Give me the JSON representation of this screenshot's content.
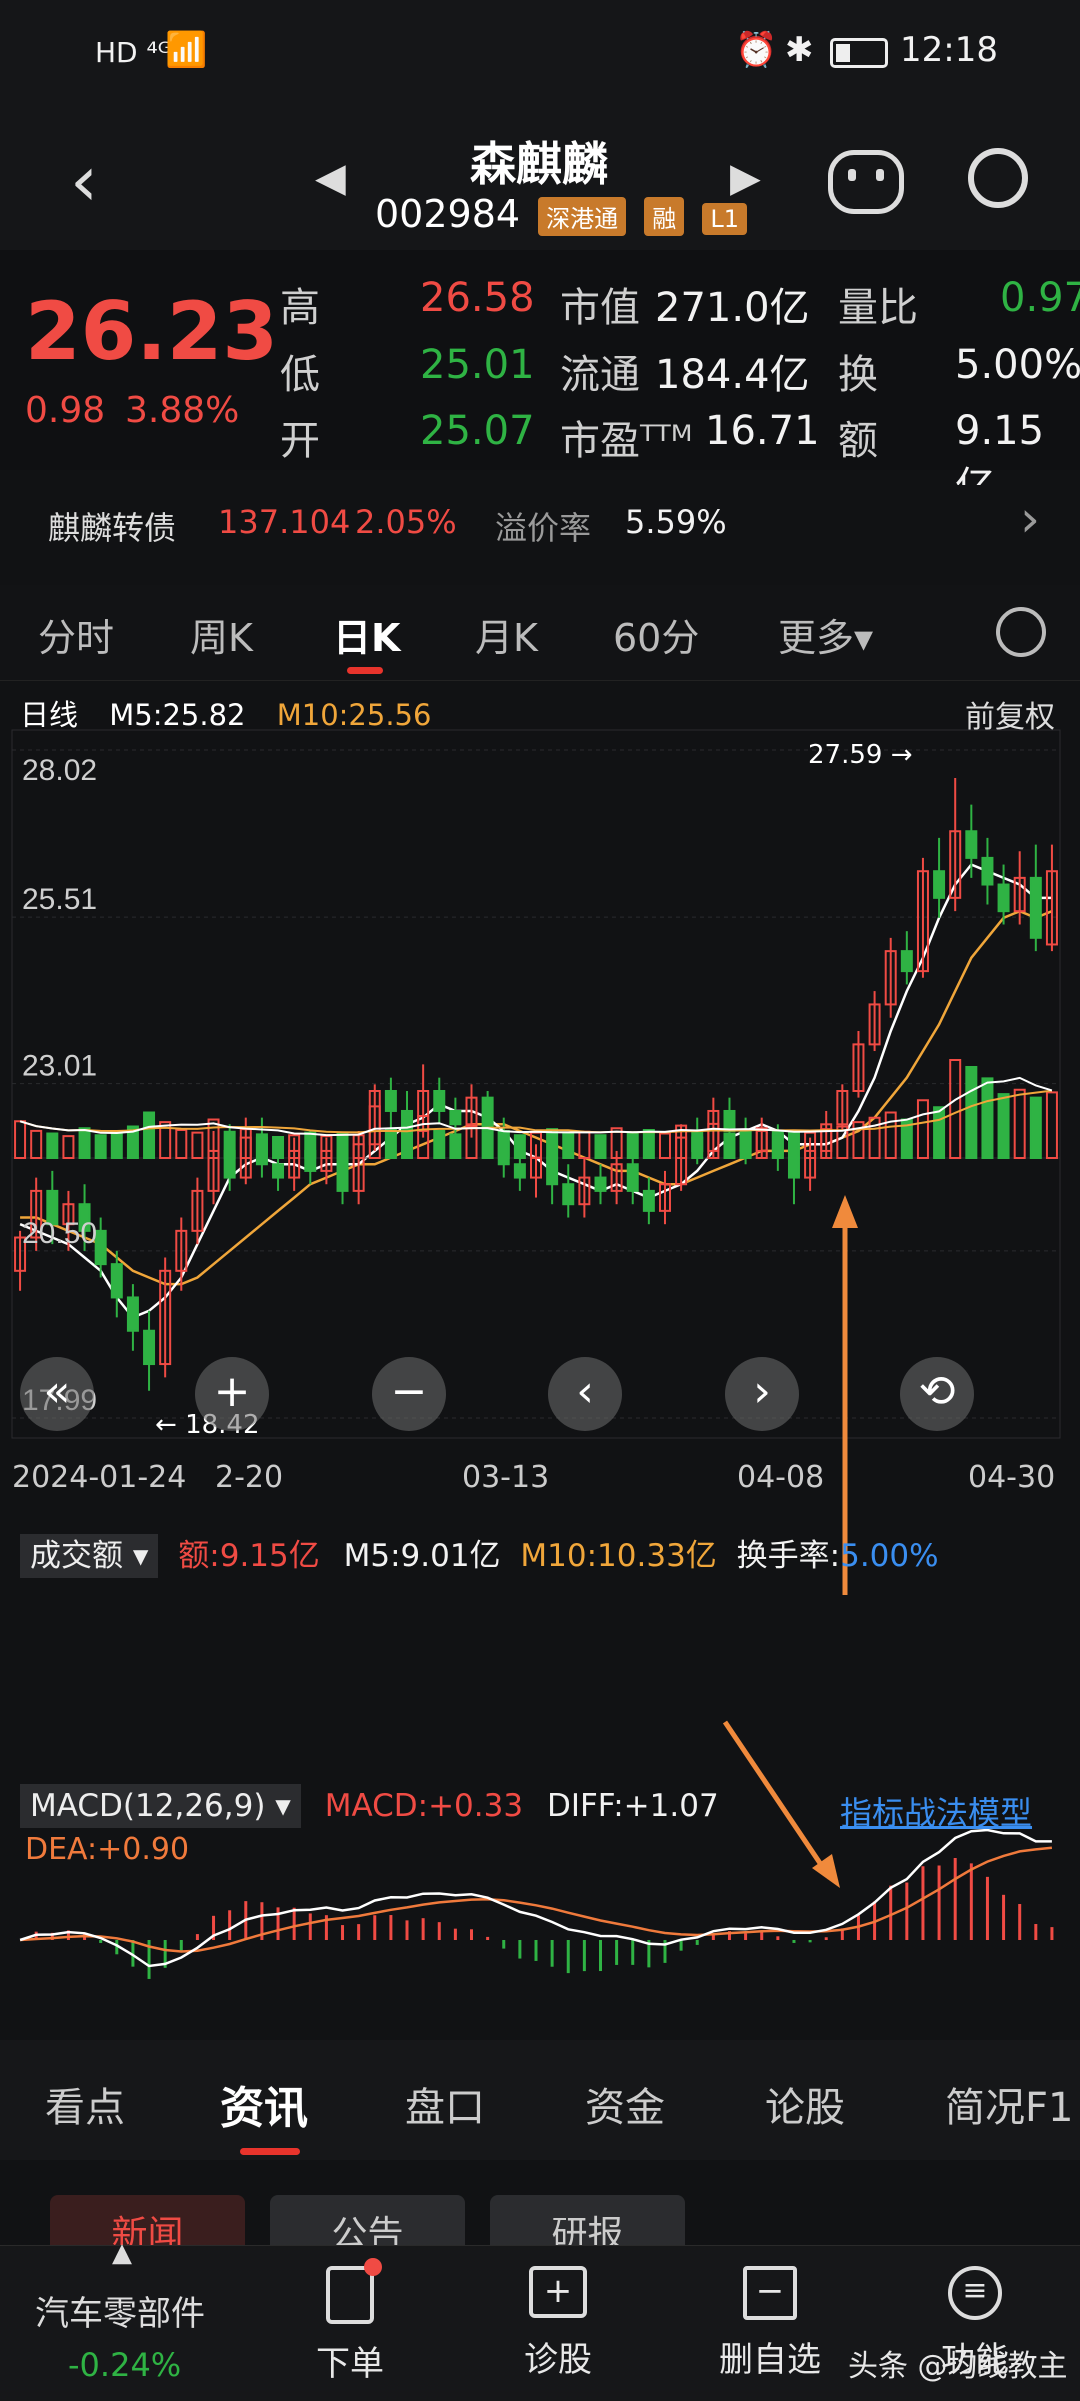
{
  "status_bar": {
    "network": "HD ⁴ᴳ",
    "time": "12:18"
  },
  "header": {
    "stock_name": "森麒麟",
    "stock_code": "002984",
    "badges": [
      "深港通",
      "融",
      "L1"
    ]
  },
  "quote": {
    "price": "26.23",
    "change": "0.98",
    "change_pct": "3.88%",
    "rows": [
      {
        "l1": "高",
        "v1": "26.58",
        "l2": "市值",
        "v2": "271.0亿",
        "l3": "量比",
        "v3": "0.97"
      },
      {
        "l1": "低",
        "v1": "25.01",
        "l2": "流通",
        "v2": "184.4亿",
        "l3": "换",
        "v3": "5.00%"
      },
      {
        "l1": "开",
        "v1": "25.07",
        "l2": "市盈ᵀᵀᴹ",
        "v2": "16.71",
        "l3": "额",
        "v3": "9.15亿"
      }
    ]
  },
  "bond": {
    "name": "麒麟转债",
    "price": "137.104",
    "pct": "2.05%",
    "premium_label": "溢价率",
    "premium": "5.59%"
  },
  "tabs": [
    "分时",
    "周K",
    "日K",
    "月K",
    "60分",
    "更多▾"
  ],
  "active_tab": "日K",
  "kline": {
    "label": "日线",
    "m5": "M5:25.82",
    "m10": "M10:25.56",
    "adjust": "前复权",
    "high_marker": "27.59",
    "low_marker": "18.42",
    "dates": [
      "2024-01-24",
      "2-20",
      "03-13",
      "04-08",
      "04-30"
    ]
  },
  "volume": {
    "title": "成交额",
    "amount": "额:9.15亿",
    "m5": "M5:9.01亿",
    "m10": "M10:10.33亿",
    "turnover_label": "换手率:",
    "turnover": "5.00%"
  },
  "macd": {
    "title": "MACD(12,26,9)",
    "macd": "MACD:+0.33",
    "diff": "DIFF:+1.07",
    "dea": "DEA:+0.90",
    "model": "指标战法模型"
  },
  "bottom_tabs": [
    "看点",
    "资讯",
    "盘口",
    "资金",
    "论股",
    "简况F1"
  ],
  "active_bottom_tab": "资讯",
  "sub_tabs": [
    "新闻",
    "公告",
    "研报"
  ],
  "footer": {
    "sector": "汽车零部件",
    "sector_pct": "-0.24%",
    "items": [
      "下单",
      "诊股",
      "删自选",
      "功能"
    ],
    "watermark": "头条 @均线教主"
  },
  "chart_data": {
    "type": "candlestick",
    "title": "",
    "y_ticks": [
      28.02,
      25.51,
      23.01,
      20.5,
      17.99
    ],
    "ylim": [
      17.99,
      28.02
    ],
    "high_marker": 27.59,
    "low_marker": 18.42,
    "candles": [
      [
        20.2,
        20.7,
        20.8,
        19.9
      ],
      [
        20.7,
        21.4,
        21.6,
        20.5
      ],
      [
        21.4,
        20.9,
        21.7,
        20.6
      ],
      [
        20.9,
        21.2,
        21.4,
        20.5
      ],
      [
        21.2,
        20.8,
        21.5,
        20.5
      ],
      [
        20.8,
        20.3,
        21.0,
        20.1
      ],
      [
        20.3,
        19.8,
        20.5,
        19.5
      ],
      [
        19.8,
        19.3,
        20.0,
        19.0
      ],
      [
        19.3,
        18.8,
        19.6,
        18.4
      ],
      [
        18.8,
        20.2,
        20.4,
        18.6
      ],
      [
        20.2,
        20.8,
        21.0,
        19.9
      ],
      [
        20.8,
        21.4,
        21.6,
        20.6
      ],
      [
        21.4,
        22.0,
        22.3,
        21.2
      ],
      [
        22.0,
        21.6,
        22.4,
        21.4
      ],
      [
        21.6,
        22.2,
        22.5,
        21.5
      ],
      [
        22.2,
        21.8,
        22.5,
        21.6
      ],
      [
        21.8,
        21.6,
        22.1,
        21.4
      ],
      [
        21.6,
        22.0,
        22.2,
        21.4
      ],
      [
        22.0,
        21.7,
        22.3,
        21.5
      ],
      [
        21.7,
        22.0,
        22.2,
        21.5
      ],
      [
        22.0,
        21.4,
        22.1,
        21.2
      ],
      [
        21.4,
        22.1,
        22.3,
        21.2
      ],
      [
        22.1,
        22.9,
        23.0,
        22.0
      ],
      [
        22.9,
        22.6,
        23.1,
        22.3
      ],
      [
        22.6,
        22.3,
        22.9,
        22.1
      ],
      [
        22.3,
        22.9,
        23.3,
        22.2
      ],
      [
        22.9,
        22.6,
        23.1,
        22.4
      ],
      [
        22.6,
        22.4,
        22.8,
        22.2
      ],
      [
        22.4,
        22.8,
        23.0,
        22.2
      ],
      [
        22.8,
        22.3,
        22.9,
        22.1
      ],
      [
        22.3,
        21.8,
        22.5,
        21.6
      ],
      [
        21.8,
        21.6,
        22.1,
        21.4
      ],
      [
        21.6,
        21.9,
        22.1,
        21.3
      ],
      [
        21.9,
        21.5,
        22.1,
        21.2
      ],
      [
        21.5,
        21.2,
        21.8,
        21.0
      ],
      [
        21.2,
        21.6,
        21.9,
        21.0
      ],
      [
        21.6,
        21.4,
        21.8,
        21.2
      ],
      [
        21.4,
        21.8,
        22.0,
        21.2
      ],
      [
        21.8,
        21.4,
        22.0,
        21.2
      ],
      [
        21.4,
        21.1,
        21.6,
        20.9
      ],
      [
        21.1,
        21.5,
        21.7,
        20.9
      ],
      [
        21.5,
        22.2,
        22.4,
        21.4
      ],
      [
        22.2,
        22.0,
        22.5,
        21.8
      ],
      [
        22.0,
        22.6,
        22.8,
        21.9
      ],
      [
        22.6,
        22.3,
        22.8,
        22.1
      ],
      [
        22.3,
        22.0,
        22.5,
        21.8
      ],
      [
        22.0,
        22.3,
        22.5,
        21.9
      ],
      [
        22.3,
        21.9,
        22.4,
        21.7
      ],
      [
        21.9,
        21.6,
        22.1,
        21.2
      ],
      [
        21.6,
        22.0,
        22.2,
        21.4
      ],
      [
        22.0,
        22.4,
        22.6,
        21.9
      ],
      [
        22.4,
        22.9,
        23.0,
        22.3
      ],
      [
        22.9,
        23.6,
        23.8,
        22.8
      ],
      [
        23.6,
        24.2,
        24.4,
        23.5
      ],
      [
        24.2,
        25.0,
        25.2,
        24.0
      ],
      [
        25.0,
        24.7,
        25.3,
        24.5
      ],
      [
        24.7,
        26.2,
        26.4,
        24.6
      ],
      [
        26.2,
        25.8,
        26.7,
        25.5
      ],
      [
        25.8,
        26.8,
        27.6,
        25.6
      ],
      [
        26.8,
        26.4,
        27.2,
        26.1
      ],
      [
        26.4,
        26.0,
        26.7,
        25.7
      ],
      [
        26.0,
        25.6,
        26.3,
        25.4
      ],
      [
        25.6,
        26.1,
        26.5,
        25.4
      ],
      [
        26.1,
        25.2,
        26.6,
        25.0
      ],
      [
        25.1,
        26.2,
        26.6,
        25.0
      ]
    ],
    "volume": [
      4.2,
      3.1,
      2.8,
      2.5,
      3.4,
      2.6,
      3.0,
      3.6,
      5.2,
      4.1,
      3.2,
      2.9,
      4.4,
      3.0,
      3.3,
      2.7,
      2.4,
      2.6,
      2.9,
      2.5,
      2.8,
      2.6,
      5.9,
      3.2,
      2.9,
      4.8,
      3.1,
      2.7,
      3.6,
      2.9,
      3.0,
      2.6,
      2.9,
      3.3,
      2.8,
      3.0,
      2.6,
      3.4,
      2.9,
      3.2,
      2.8,
      3.7,
      3.1,
      3.9,
      2.8,
      3.0,
      3.4,
      2.7,
      3.1,
      2.9,
      3.3,
      3.6,
      4.1,
      4.6,
      5.2,
      4.4,
      6.6,
      5.8,
      11.2,
      10.4,
      9.1,
      7.3,
      7.8,
      6.9,
      7.5
    ],
    "m5": [
      20.9,
      20.8,
      20.7,
      20.6,
      20.4,
      20.2,
      19.8,
      19.5,
      19.6,
      19.8,
      20.1,
      20.6,
      21.1,
      21.6,
      21.8,
      21.9,
      21.8,
      21.8,
      21.7,
      21.8,
      21.8,
      21.8,
      22.0,
      22.2,
      22.4,
      22.5,
      22.7,
      22.6,
      22.6,
      22.5,
      22.3,
      22.0,
      21.9,
      21.7,
      21.6,
      21.5,
      21.4,
      21.5,
      21.4,
      21.3,
      21.4,
      21.5,
      21.7,
      22.0,
      22.2,
      22.3,
      22.4,
      22.3,
      22.1,
      22.1,
      22.1,
      22.2,
      22.6,
      23.1,
      23.8,
      24.4,
      24.9,
      25.5,
      26.0,
      26.3,
      26.2,
      26.1,
      26.0,
      25.8,
      25.8
    ],
    "m10": [
      21.0,
      21.0,
      20.9,
      20.8,
      20.7,
      20.6,
      20.4,
      20.2,
      20.1,
      20.0,
      20.0,
      20.1,
      20.3,
      20.5,
      20.7,
      20.9,
      21.1,
      21.3,
      21.5,
      21.6,
      21.7,
      21.8,
      21.8,
      21.9,
      22.0,
      22.1,
      22.2,
      22.3,
      22.4,
      22.4,
      22.4,
      22.3,
      22.2,
      22.1,
      22.0,
      21.9,
      21.8,
      21.7,
      21.7,
      21.6,
      21.5,
      21.5,
      21.6,
      21.7,
      21.8,
      21.9,
      22.0,
      22.0,
      22.0,
      22.1,
      22.1,
      22.2,
      22.3,
      22.5,
      22.8,
      23.1,
      23.5,
      23.9,
      24.4,
      24.9,
      25.2,
      25.5,
      25.6,
      25.5,
      25.6
    ]
  }
}
